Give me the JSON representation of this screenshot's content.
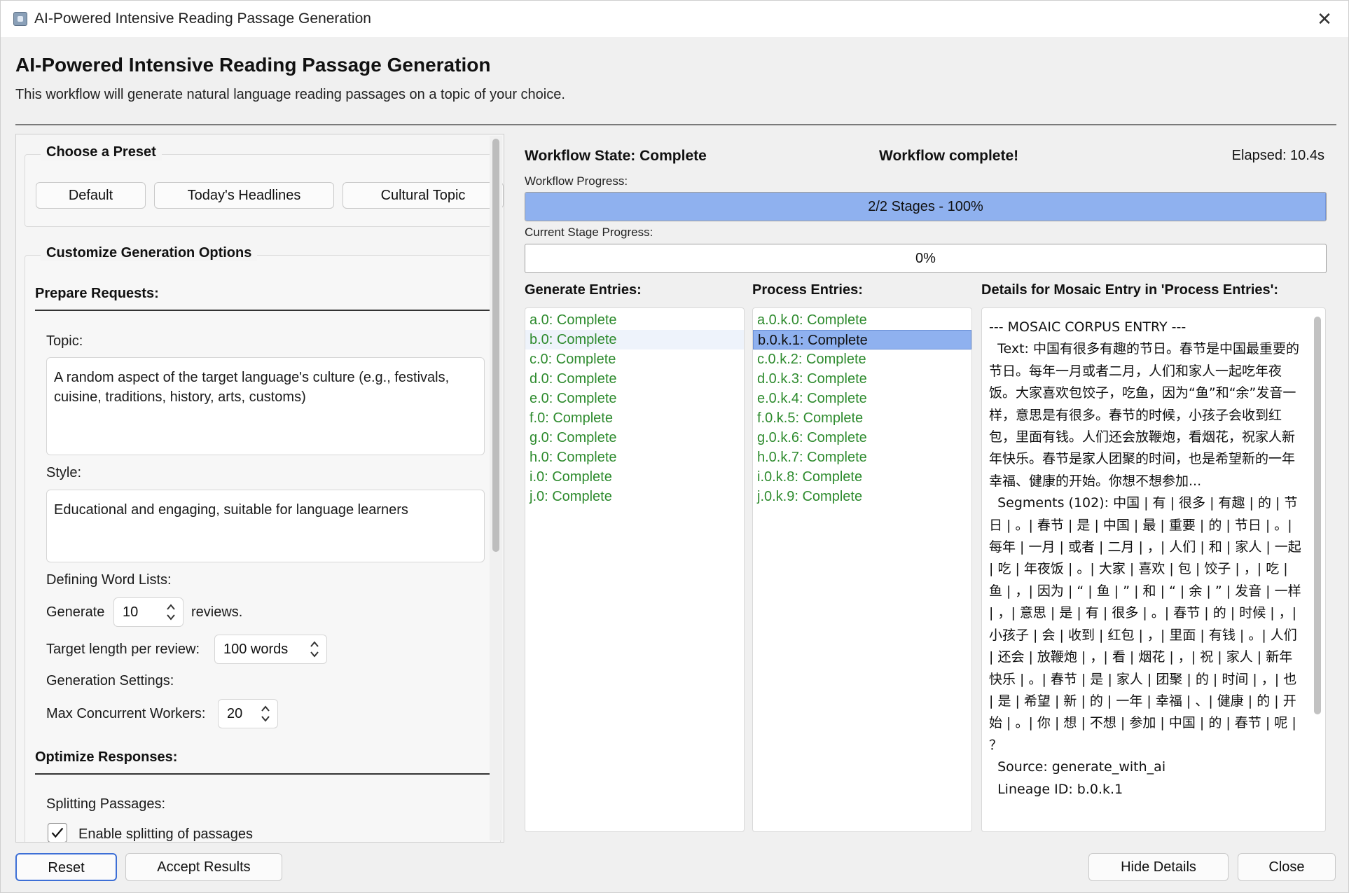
{
  "window": {
    "title": "AI-Powered Intensive Reading Passage Generation",
    "close_glyph": "✕"
  },
  "header": {
    "title": "AI-Powered Intensive Reading Passage Generation",
    "subtitle": "This workflow will generate natural language reading passages on a topic of your choice."
  },
  "presets": {
    "group_label": "Choose a Preset",
    "buttons": [
      "Default",
      "Today's Headlines",
      "Cultural Topic"
    ]
  },
  "options": {
    "group_label": "Customize Generation Options",
    "prepare_heading": "Prepare Requests:",
    "topic_label": "Topic:",
    "topic_value": "A random aspect of the target language's culture (e.g., festivals, cuisine, traditions, history, arts, customs)",
    "style_label": "Style:",
    "style_value": "Educational and engaging, suitable for language learners",
    "word_lists_label": "Defining Word Lists:",
    "generate_label": "Generate",
    "generate_value": "10",
    "reviews_label": "reviews.",
    "target_length_label": "Target length per review:",
    "target_length_value": "100 words",
    "generation_settings_label": "Generation Settings:",
    "max_workers_label": "Max Concurrent Workers:",
    "max_workers_value": "20",
    "optimize_heading": "Optimize Responses:",
    "splitting_label": "Splitting Passages:",
    "enable_splitting_label": "Enable splitting of passages",
    "enable_splitting_checked": true
  },
  "status": {
    "state": "Workflow State: Complete",
    "message": "Workflow complete!",
    "elapsed": "Elapsed: 10.4s",
    "workflow_progress_label": "Workflow Progress:",
    "workflow_progress_text": "2/2 Stages - 100%",
    "workflow_progress_value": 1.0,
    "stage_progress_label": "Current Stage Progress:",
    "stage_progress_text": "0%",
    "stage_progress_value": 0.0
  },
  "generate_entries": {
    "heading": "Generate Entries:",
    "items": [
      "a.0: Complete",
      "b.0: Complete",
      "c.0: Complete",
      "d.0: Complete",
      "e.0: Complete",
      "f.0: Complete",
      "g.0: Complete",
      "h.0: Complete",
      "i.0: Complete",
      "j.0: Complete"
    ]
  },
  "process_entries": {
    "heading": "Process Entries:",
    "items": [
      "a.0.k.0: Complete",
      "b.0.k.1: Complete",
      "c.0.k.2: Complete",
      "d.0.k.3: Complete",
      "e.0.k.4: Complete",
      "f.0.k.5: Complete",
      "g.0.k.6: Complete",
      "h.0.k.7: Complete",
      "i.0.k.8: Complete",
      "j.0.k.9: Complete"
    ],
    "selected_index": 1
  },
  "details": {
    "heading": "Details for Mosaic Entry in 'Process Entries':",
    "text": "--- MOSAIC CORPUS ENTRY ---\n  Text: 中国有很多有趣的节日。春节是中国最重要的节日。每年一月或者二月，人们和家人一起吃年夜饭。大家喜欢包饺子，吃鱼，因为“鱼”和“余”发音一样，意思是有很多。春节的时候，小孩子会收到红包，里面有钱。人们还会放鞭炮，看烟花，祝家人新年快乐。春节是家人团聚的时间，也是希望新的一年幸福、健康的开始。你想不想参加...\n  Segments (102): 中国 | 有 | 很多 | 有趣 | 的 | 节日 | 。| 春节 | 是 | 中国 | 最 | 重要 | 的 | 节日 | 。| 每年 | 一月 | 或者 | 二月 | ，| 人们 | 和 | 家人 | 一起 | 吃 | 年夜饭 | 。| 大家 | 喜欢 | 包 | 饺子 | ，| 吃 | 鱼 | ，| 因为 | “ | 鱼 | ” | 和 | “ | 余 | ” | 发音 | 一样 | ，| 意思 | 是 | 有 | 很多 | 。| 春节 | 的 | 时候 | ，| 小孩子 | 会 | 收到 | 红包 | ，| 里面 | 有钱 | 。| 人们 | 还会 | 放鞭炮 | ，| 看 | 烟花 | ，| 祝 | 家人 | 新年快乐 | 。| 春节 | 是 | 家人 | 团聚 | 的 | 时间 | ，| 也 | 是 | 希望 | 新 | 的 | 一年 | 幸福 | 、| 健康 | 的 | 开始 | 。| 你 | 想 | 不想 | 参加 | 中国 | 的 | 春节 | 呢 | ？\n  Source: generate_with_ai\n  Lineage ID: b.0.k.1"
  },
  "footer": {
    "reset": "Reset",
    "accept": "Accept Results",
    "hide_details": "Hide Details",
    "close": "Close"
  },
  "colors": {
    "complete_green": "#2e8b2e",
    "selection_blue": "#8fb1ef"
  }
}
